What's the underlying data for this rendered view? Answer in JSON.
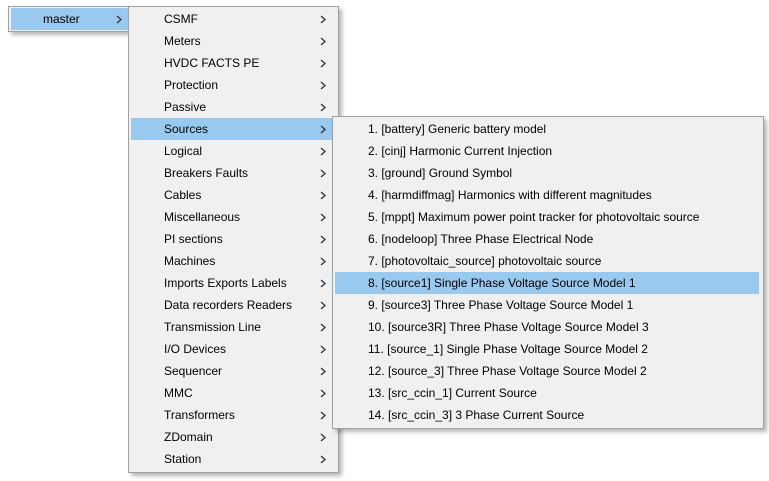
{
  "root_menu": {
    "items": [
      {
        "label": "master",
        "has_submenu": true,
        "highlighted": true
      }
    ]
  },
  "library_menu": {
    "items": [
      {
        "label": "CSMF",
        "has_submenu": true
      },
      {
        "label": "Meters",
        "has_submenu": true
      },
      {
        "label": "HVDC FACTS PE",
        "has_submenu": true
      },
      {
        "label": "Protection",
        "has_submenu": true
      },
      {
        "label": "Passive",
        "has_submenu": true
      },
      {
        "label": "Sources",
        "has_submenu": true,
        "highlighted": true
      },
      {
        "label": "Logical",
        "has_submenu": true
      },
      {
        "label": "Breakers Faults",
        "has_submenu": true
      },
      {
        "label": "Cables",
        "has_submenu": true
      },
      {
        "label": "Miscellaneous",
        "has_submenu": true
      },
      {
        "label": "PI sections",
        "has_submenu": true
      },
      {
        "label": "Machines",
        "has_submenu": true
      },
      {
        "label": "Imports Exports Labels",
        "has_submenu": true
      },
      {
        "label": "Data recorders Readers",
        "has_submenu": true
      },
      {
        "label": "Transmission Line",
        "has_submenu": true
      },
      {
        "label": "I/O Devices",
        "has_submenu": true
      },
      {
        "label": "Sequencer",
        "has_submenu": true
      },
      {
        "label": "MMC",
        "has_submenu": true
      },
      {
        "label": "Transformers",
        "has_submenu": true
      },
      {
        "label": "ZDomain",
        "has_submenu": true
      },
      {
        "label": "Station",
        "has_submenu": true
      }
    ]
  },
  "sources_menu": {
    "items": [
      {
        "label": "1. [battery] Generic battery model"
      },
      {
        "label": "2. [cinj] Harmonic Current Injection"
      },
      {
        "label": "3. [ground] Ground Symbol"
      },
      {
        "label": "4. [harmdiffmag] Harmonics with different magnitudes"
      },
      {
        "label": "5. [mppt] Maximum power point tracker for photovoltaic source"
      },
      {
        "label": "6. [nodeloop] Three Phase Electrical Node"
      },
      {
        "label": "7. [photovoltaic_source] photovoltaic source"
      },
      {
        "label": "8. [source1] Single Phase Voltage Source Model 1",
        "highlighted": true
      },
      {
        "label": "9. [source3] Three Phase Voltage Source Model 1"
      },
      {
        "label": "10. [source3R] Three Phase Voltage Source Model 3"
      },
      {
        "label": "11. [source_1] Single Phase Voltage Source Model 2"
      },
      {
        "label": "12. [source_3] Three Phase Voltage Source Model 2"
      },
      {
        "label": "13. [src_ccin_1] Current Source"
      },
      {
        "label": "14. [src_ccin_3] 3 Phase Current Source"
      }
    ]
  },
  "icons": {
    "submenu_arrow": "chevron-right-icon"
  },
  "colors": {
    "menu_background": "#f0f0f0",
    "highlight": "#99c9ef",
    "border": "#a0a0a0"
  }
}
